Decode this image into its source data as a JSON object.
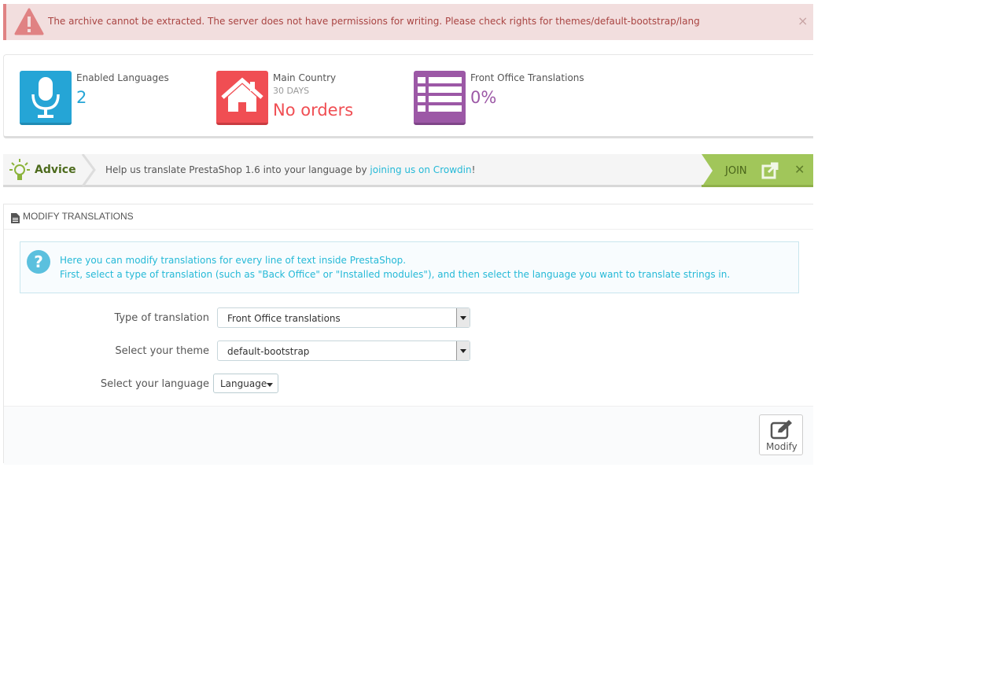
{
  "alert": {
    "message": "The archive cannot be extracted. The server does not have permissions for writing. Please check rights for themes/default-bootstrap/lang",
    "close_glyph": "×",
    "icon": "warning-triangle-icon",
    "color": "#a94442"
  },
  "kpis": [
    {
      "label": "Enabled Languages",
      "sub": "",
      "value": "2",
      "icon": "microphone-icon",
      "color": "#25a5d6"
    },
    {
      "label": "Main Country",
      "sub": "30 DAYS",
      "value": "No orders",
      "icon": "home-icon",
      "color": "#f04e53"
    },
    {
      "label": "Front Office Translations",
      "sub": "",
      "value": "0%",
      "icon": "list-icon",
      "color": "#9c58a6"
    }
  ],
  "advice": {
    "title": "Advice",
    "text_before": "Help us translate PrestaShop 1.6 into your language by ",
    "link_text": "joining us on Crowdin",
    "text_after": "!",
    "join_label": "JOIN",
    "close_glyph": "✕",
    "join_color": "#a1c65a"
  },
  "panel": {
    "heading": "MODIFY TRANSLATIONS",
    "info_line1": "Here you can modify translations for every line of text inside PrestaShop.",
    "info_line2": "First, select a type of translation (such as \"Back Office\" or \"Installed modules\"), and then select the language you want to translate strings in.",
    "info_icon_glyph": "?",
    "fields": {
      "type_label": "Type of translation",
      "type_value": "Front Office translations",
      "theme_label": "Select your theme",
      "theme_value": "default-bootstrap",
      "language_label": "Select your language",
      "language_value": "Language"
    },
    "modify_label": "Modify"
  }
}
